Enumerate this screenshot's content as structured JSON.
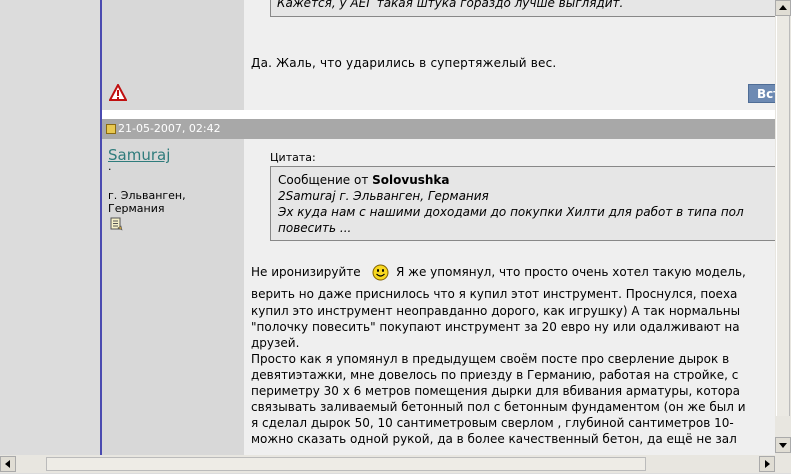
{
  "post1": {
    "quote_line": "Кажется, у АЕГ такая штука гораздо лучше выглядит.",
    "text": "Да. Жаль, что ударились в супертяжелый вес.",
    "reply_label": "Вст"
  },
  "post2": {
    "date": "21-05-2007, 02:42",
    "username": "Samuraj",
    "user_dot": "·",
    "location_line1": "г. Эльванген,",
    "location_line2": "Германия",
    "quote_label": "Цитата:",
    "quote_title_prefix": "Сообщение от ",
    "quote_author": "Solovushka",
    "quote_line1": "2Samuraj г. Эльванген, Германия",
    "quote_line2": "Эх куда нам с нашими доходами до покупки Хилти для работ в типа пол",
    "quote_line3": "повесить ...",
    "body_line1_a": "Не иронизируйте",
    "body_line1_b": "Я же упомянул, что просто очень хотел такую модель,",
    "body_line2": "верить но даже приснилось что я купил этот инструмент. Проснулся, поеха",
    "body_line3": "купил это инструмент неоправданно дорого, как игрушку) А так нормальны",
    "body_line4": "\"полочку повесить\" покупают инструмент за 20 евро ну или одалживают на",
    "body_line5": "друзей.",
    "body_line6": "Просто как я упомянул в предыдущем своём посте про сверление дырок в",
    "body_line7": "девятиэтажки, мне довелось по приезду в Германию, работая на стройке, с",
    "body_line8": "периметру 30 х 6 метров помещения дырки для вбивания арматуры, котора",
    "body_line9": "связывать заливаемый бетонный пол с бетонным фундаментом (он же был и",
    "body_line10": "я сделал дырок 50, 10 сантиметровым сверлом , глубиной сантиметров 10-",
    "body_line11": "можно сказать одной рукой, да в более качественный бетон, да ещё не зал"
  },
  "icons": {
    "warning": "warning-icon",
    "post": "post-icon",
    "profile": "profile-icon",
    "smiley": "smiley-icon"
  },
  "colors": {
    "header_bar": "#a8a8a8",
    "username": "#2f7c7c",
    "button": "#6d8ab3",
    "left_border": "#4a4ab0"
  }
}
